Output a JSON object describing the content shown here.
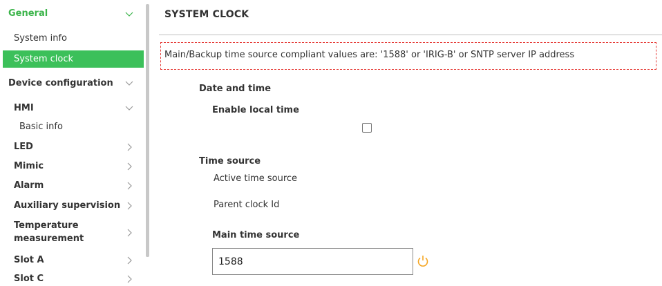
{
  "sidebar": {
    "general": "General",
    "system_info": "System info",
    "system_clock": "System clock",
    "device_configuration": "Device configuration",
    "hmi": "HMI",
    "basic_info": "Basic info",
    "led": "LED",
    "mimic": "Mimic",
    "alarm": "Alarm",
    "auxiliary_supervision": "Auxiliary supervision",
    "temperature_line1": "Temperature",
    "temperature_line2": "measurement",
    "slot_a": "Slot A",
    "slot_c": "Slot C"
  },
  "main": {
    "title": "SYSTEM CLOCK",
    "notice": "Main/Backup time source compliant values are: '1588' or 'IRIG-B' or SNTP server IP address",
    "date_and_time": "Date and time",
    "enable_local_time": "Enable local time",
    "enable_local_time_checked": false,
    "time_source": "Time source",
    "active_time_source": "Active time source",
    "parent_clock_id": "Parent clock Id",
    "main_time_source_label": "Main time source",
    "main_time_source_value": "1588"
  },
  "colors": {
    "accent_green": "#3cc05a",
    "notice_border": "#e53935",
    "refresh_icon": "#f5a623"
  },
  "icons": {
    "expand": "chevron-down-icon",
    "collapsed": "chevron-right-icon",
    "reset": "refresh-icon"
  }
}
